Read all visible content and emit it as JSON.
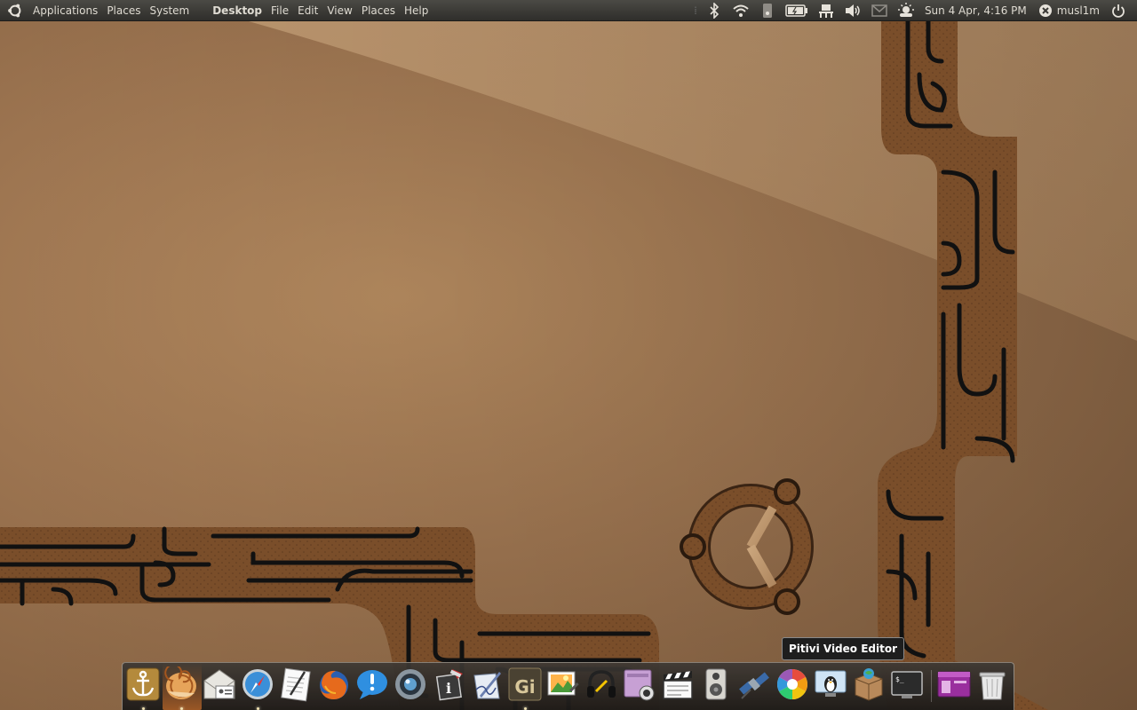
{
  "top_panel": {
    "menus": [
      "Applications",
      "Places",
      "System"
    ],
    "app_name": "Desktop",
    "app_menus": [
      "File",
      "Edit",
      "View",
      "Places",
      "Help"
    ],
    "tray_icons": [
      "bluetooth-icon",
      "wifi-icon",
      "drive-icon",
      "battery-icon",
      "network-icon",
      "volume-icon",
      "mail-icon",
      "weather-icon"
    ],
    "clock": "Sun 4 Apr, 4:16 PM",
    "user": "musl1m",
    "power_icon": "power-icon"
  },
  "tooltip": {
    "text": "Pitivi Video Editor"
  },
  "dock": {
    "items": [
      "anchor-icon",
      "nautilus-shell-icon",
      "mail-contacts-icon",
      "safari-compass-icon",
      "text-editor-icon",
      "firefox-icon",
      "notification-bubble-icon",
      "camera-lens-icon",
      "info-tool-icon",
      "pen-paper-icon",
      "gimp-gi-icon",
      "image-viewer-icon",
      "headphones-icon",
      "screenshot-icon",
      "clapperboard-icon",
      "speaker-icon",
      "satellite-icon",
      "color-wheel-icon",
      "penguin-monitor-icon",
      "package-box-icon",
      "terminal-icon",
      "window-manager-icon",
      "trash-icon"
    ],
    "running": [
      "anchor-icon",
      "nautilus-shell-icon",
      "safari-compass-icon",
      "gimp-gi-icon"
    ],
    "active": "nautilus-shell-icon"
  },
  "colors": {
    "panel": "#3a3935",
    "wallpaper": "#9c7450",
    "accent_active": "#b06228"
  }
}
